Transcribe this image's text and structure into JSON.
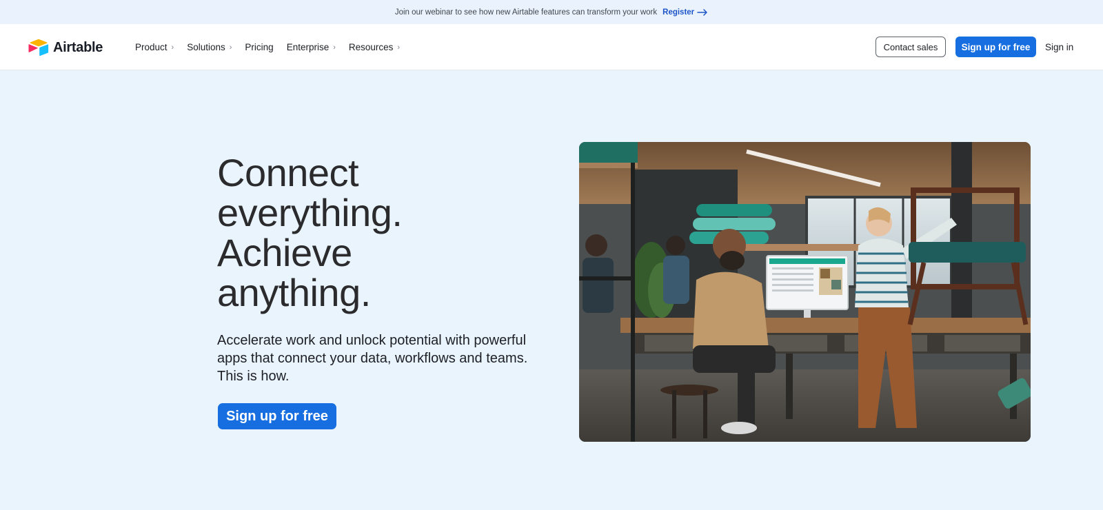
{
  "banner": {
    "text": "Join our webinar to see how new Airtable features can transform your work",
    "link_label": "Register"
  },
  "header": {
    "logo_text": "Airtable",
    "nav": [
      {
        "label": "Product",
        "has_chevron": true
      },
      {
        "label": "Solutions",
        "has_chevron": true
      },
      {
        "label": "Pricing",
        "has_chevron": false
      },
      {
        "label": "Enterprise",
        "has_chevron": true
      },
      {
        "label": "Resources",
        "has_chevron": true
      }
    ],
    "chevron_glyph": "›",
    "contact_sales_label": "Contact sales",
    "signup_label": "Sign up for free",
    "signin_label": "Sign in"
  },
  "hero": {
    "title_lines": [
      "Connect",
      "everything.",
      "Achieve",
      "anything."
    ],
    "subtitle": "Accelerate work and unlock potential with powerful apps that connect your data, workflows and teams. This is how.",
    "cta_label": "Sign up for free",
    "image_subject": "office-team-photo"
  },
  "icons": {
    "logo": "airtable-logo-icon",
    "register_arrow": "arrow-right-icon",
    "nav_chevron": "chevron-right-icon"
  },
  "colors": {
    "page_bg": "#eaf4fc",
    "primary": "#166ee1",
    "link": "#1d55c9",
    "text": "#1d1f25"
  }
}
